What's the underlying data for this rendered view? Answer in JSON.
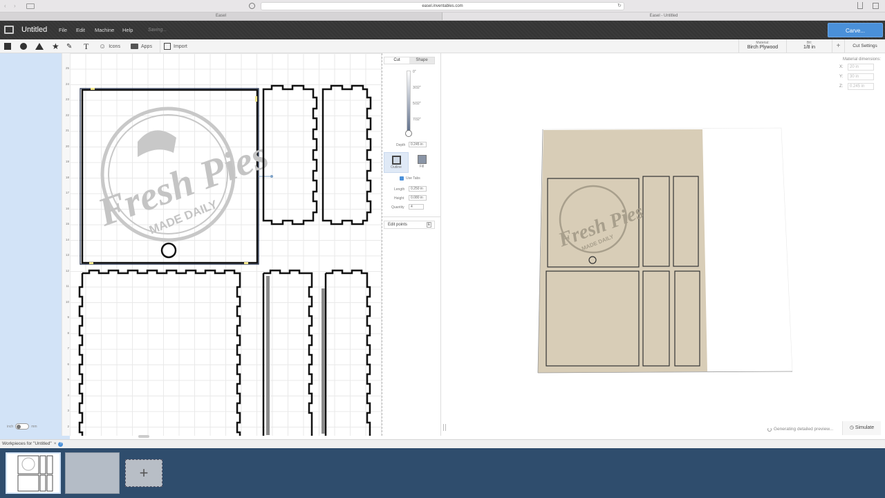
{
  "browser": {
    "url": "easel.inventables.com",
    "tab_left": "Easel",
    "tab_right": "Easel - Untitled"
  },
  "header": {
    "title": "Untitled",
    "menu": [
      "File",
      "Edit",
      "Machine",
      "Help"
    ],
    "status": "Saving...",
    "carve_label": "Carve..."
  },
  "toolbar": {
    "icons_label": "Icons",
    "apps_label": "Apps",
    "import_label": "Import"
  },
  "material": {
    "label": "Material:",
    "value": "Birch Plywood",
    "bit_label": "Bit:",
    "bit_value": "1/8 in",
    "cut_settings_label": "Cut Settings"
  },
  "ruler": {
    "ticks": [
      "25",
      "24",
      "23",
      "22",
      "21",
      "20",
      "19",
      "18",
      "17",
      "16",
      "15",
      "14",
      "13",
      "12",
      "11",
      "10",
      "9",
      "8",
      "7",
      "6",
      "5",
      "4",
      "3",
      "2"
    ]
  },
  "units": {
    "inch": "inch",
    "mm": "mm"
  },
  "logo": {
    "line1": "Fresh Pies",
    "line2": "MADE DAILY"
  },
  "props": {
    "tab_cut": "Cut",
    "tab_shape": "Shape",
    "depth_ticks": [
      "0\"",
      "3/32\"",
      "5/32\"",
      "7/32\""
    ],
    "depth_label": "Depth",
    "depth_value": "0.245 in",
    "outline_label": "Outline",
    "fill_label": "Fill",
    "use_tabs_label": "Use Tabs",
    "length_label": "Length",
    "length_value": "0.250 in",
    "height_label": "Height",
    "height_value": "0.080 in",
    "quantity_label": "Quantity",
    "quantity_value": "4",
    "edit_points_label": "Edit points"
  },
  "dimensions": {
    "title": "Material dimensions:",
    "x_label": "X:",
    "x_value": "20 in",
    "y_label": "Y:",
    "y_value": "30 in",
    "z_label": "Z:",
    "z_value": "0.245 in"
  },
  "preview": {
    "status": "Generating detailed preview...",
    "simulate_label": "Simulate"
  },
  "workpieces": {
    "label": "Workpieces for \"Untitled\""
  }
}
